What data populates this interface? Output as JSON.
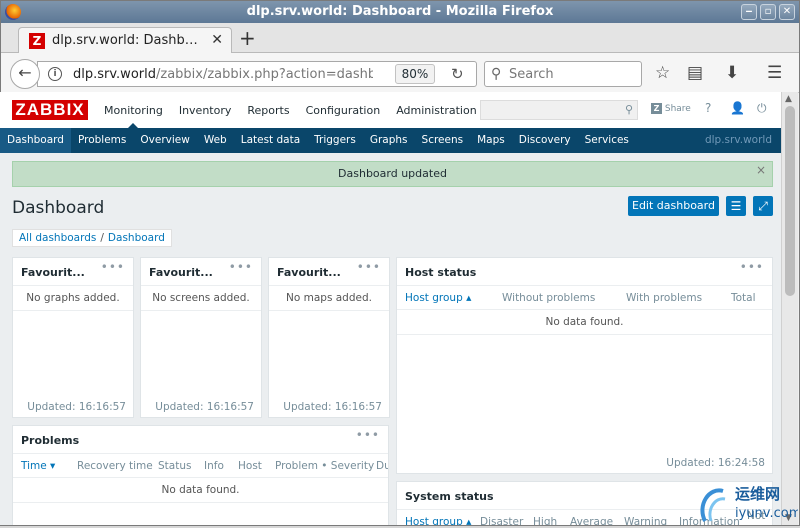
{
  "window": {
    "title": "dlp.srv.world: Dashboard - Mozilla Firefox"
  },
  "tab": {
    "title": "dlp.srv.world: Dashb…",
    "favicon": "Z"
  },
  "nav": {
    "url_host": "dlp.srv.world",
    "url_path": "/zabbix/zabbix.php?action=dashb",
    "zoom": "80%",
    "search_placeholder": "Search"
  },
  "zabbix": {
    "logo": "ZABBIX",
    "menu": [
      "Monitoring",
      "Inventory",
      "Reports",
      "Configuration",
      "Administration"
    ],
    "share": "Share",
    "submenu": [
      "Dashboard",
      "Problems",
      "Overview",
      "Web",
      "Latest data",
      "Triggers",
      "Graphs",
      "Screens",
      "Maps",
      "Discovery",
      "Services"
    ],
    "server": "dlp.srv.world"
  },
  "message": "Dashboard updated",
  "page_title": "Dashboard",
  "edit_button": "Edit dashboard",
  "breadcrumb": [
    "All dashboards",
    "Dashboard"
  ],
  "widgets": {
    "fav_graphs": {
      "title": "Favourit...",
      "empty": "No graphs added.",
      "updated": "Updated: 16:16:57"
    },
    "fav_screens": {
      "title": "Favourit...",
      "empty": "No screens added.",
      "updated": "Updated: 16:16:57"
    },
    "fav_maps": {
      "title": "Favourit...",
      "empty": "No maps added.",
      "updated": "Updated: 16:16:57"
    },
    "host_status": {
      "title": "Host status",
      "cols": [
        "Host group ▴",
        "Without problems",
        "With problems",
        "Total"
      ],
      "empty": "No data found.",
      "updated": "Updated: 16:24:58"
    },
    "problems": {
      "title": "Problems",
      "cols": [
        "Time ▾",
        "Recovery time",
        "Status",
        "Info",
        "Host",
        "Problem • Severity",
        "Du"
      ],
      "empty": "No data found."
    },
    "system_status": {
      "title": "System status",
      "cols": [
        "Host group ▴",
        "Disaster",
        "High",
        "Average",
        "Warning",
        "Information",
        "Not c"
      ]
    }
  },
  "watermark": {
    "cn": "运维网",
    "en": "iyunv.com"
  },
  "colors": {
    "brand": "#d40000",
    "nav": "#0a466a",
    "accent": "#0275b8",
    "success_bg": "#c2ddc7"
  }
}
